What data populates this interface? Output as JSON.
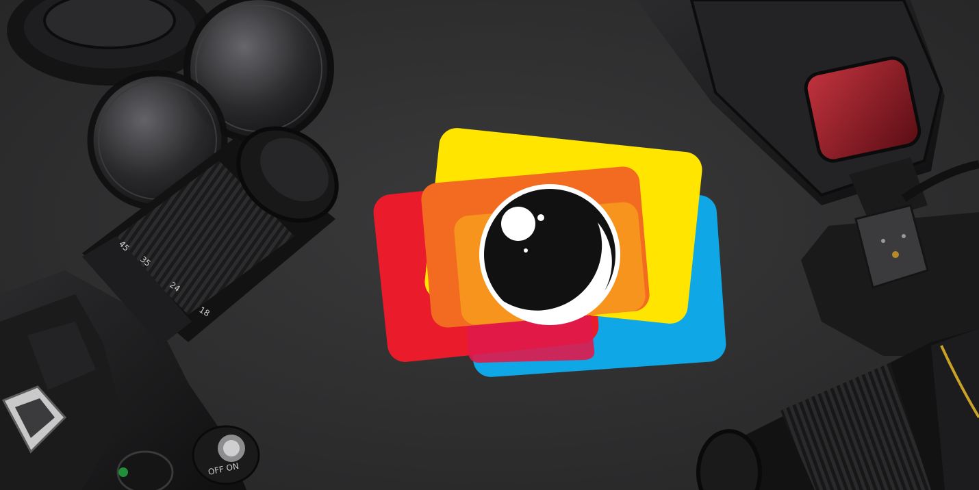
{
  "scene": {
    "description_label": "",
    "background_color": "#2c2c2d"
  },
  "logo": {
    "icon": "camera-photo-cards-icon",
    "colors": {
      "yellow": "#ffe500",
      "red": "#ea1c2b",
      "blue": "#0fa7e6",
      "orange": "#f58220",
      "lens": "#111111",
      "highlight": "#ffffff"
    }
  },
  "lens_markings": {
    "m45": "45",
    "m35": "35",
    "m24": "24",
    "m18": "18"
  },
  "camera_dial": {
    "label": "OFF ON"
  },
  "objects": [
    "camera-body-icon",
    "zoom-lens-icon",
    "lens-filter-icon",
    "flash-unit-icon",
    "telephoto-lens-icon"
  ]
}
